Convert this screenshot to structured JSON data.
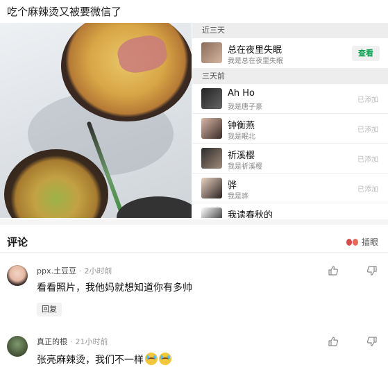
{
  "post": {
    "title": "吃个麻辣烫又被要微信了"
  },
  "contacts": {
    "sections": [
      {
        "header": "近三天"
      },
      {
        "header": "三天前"
      }
    ],
    "recent": {
      "name": "总在夜里失眠",
      "sub": "我是总在夜里失眠",
      "button": "查看"
    },
    "older": [
      {
        "name": "Ah Ho",
        "sub": "我是唐子豪",
        "status": "已添加"
      },
      {
        "name": "钟衡燕",
        "sub": "我是眠北",
        "status": "已添加"
      },
      {
        "name": "祈溪樱",
        "sub": "我是祈溪樱",
        "status": "已添加"
      },
      {
        "name": "骅",
        "sub": "我是骅",
        "status": "已添加"
      },
      {
        "name": "我读春秋的",
        "sub": "",
        "status": ""
      }
    ]
  },
  "comments": {
    "title": "评论",
    "insert_label": "插眼",
    "items": [
      {
        "user": "ppx.土豆豆",
        "time": "2小时前",
        "text": "看看照片，我他妈就想知道你有多帅",
        "reply": "回复"
      },
      {
        "user": "真正的根",
        "time": "21小时前",
        "text": "张亮麻辣烫，我们不一样"
      }
    ]
  },
  "colors": {
    "accent_green": "#07a050",
    "section_bg": "#ededed"
  }
}
